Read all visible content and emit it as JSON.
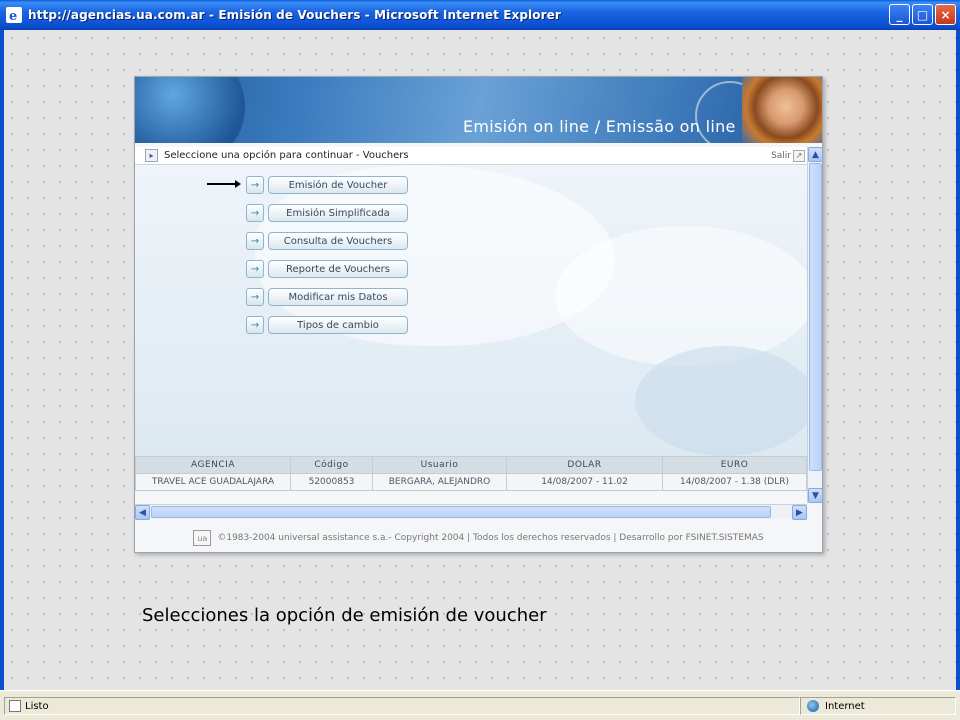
{
  "window": {
    "title": "http://agencias.ua.com.ar - Emisión de Vouchers - Microsoft Internet Explorer",
    "buttons": [
      "minimize",
      "maximize",
      "close"
    ]
  },
  "banner": {
    "title": "Emisión on line / Emissão on line"
  },
  "nav": {
    "label": "Seleccione una opción para continuar - Vouchers",
    "salir": "Salir"
  },
  "menu": {
    "items": [
      {
        "label": "Emisión de Voucher"
      },
      {
        "label": "Emisión Simplificada"
      },
      {
        "label": "Consulta de Vouchers"
      },
      {
        "label": "Reporte de Vouchers"
      },
      {
        "label": "Modificar mis Datos"
      },
      {
        "label": "Tipos de cambio"
      }
    ],
    "go_glyph": "→"
  },
  "info_table": {
    "headers": [
      "AGENCIA",
      "Código",
      "Usuario",
      "DOLAR",
      "EURO"
    ],
    "row": [
      "TRAVEL ACE GUADALAJARA",
      "52000853",
      "BERGARA, ALEJANDRO",
      "14/08/2007 - 11.02",
      "14/08/2007 - 1.38 (DLR)"
    ]
  },
  "footer": {
    "text": "©1983-2004 universal assistance s.a.- Copyright 2004 | Todos los derechos reservados | Desarrollo por FSINET.SISTEMAS"
  },
  "caption": "Selecciones la opción de emisión de voucher",
  "statusbar": {
    "left": "Listo",
    "zone": "Internet"
  }
}
